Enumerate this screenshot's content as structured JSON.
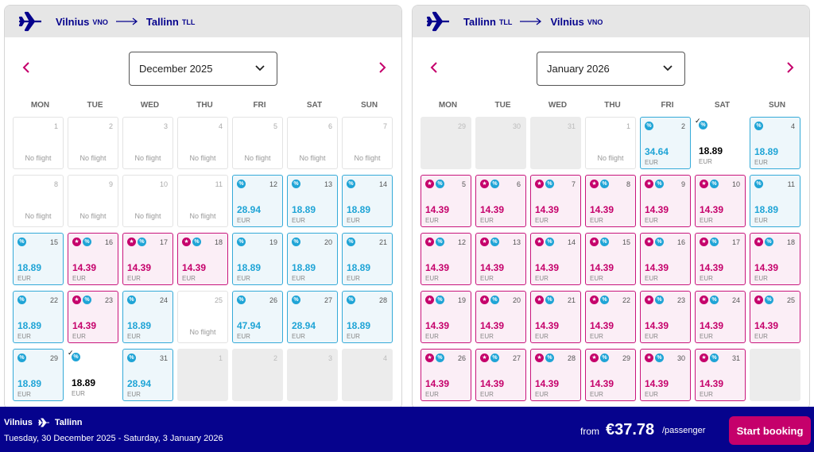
{
  "colors": {
    "brand_navy": "#06038d",
    "brand_pink": "#c5006b",
    "discount_blue": "#1fa4d6",
    "selected_green": "#2e7d4e"
  },
  "outbound": {
    "from_city": "Vilnius",
    "from_code": "VNO",
    "to_city": "Tallinn",
    "to_code": "TLL",
    "month_label": "December 2025",
    "weekdays": [
      "MON",
      "TUE",
      "WED",
      "THU",
      "FRI",
      "SAT",
      "SUN"
    ],
    "days": [
      {
        "day": "1",
        "status": "noflight",
        "label": "No flight"
      },
      {
        "day": "2",
        "status": "noflight",
        "label": "No flight"
      },
      {
        "day": "3",
        "status": "noflight",
        "label": "No flight"
      },
      {
        "day": "4",
        "status": "noflight",
        "label": "No flight"
      },
      {
        "day": "5",
        "status": "noflight",
        "label": "No flight"
      },
      {
        "day": "6",
        "status": "noflight",
        "label": "No flight"
      },
      {
        "day": "7",
        "status": "noflight",
        "label": "No flight"
      },
      {
        "day": "8",
        "status": "noflight",
        "label": "No flight"
      },
      {
        "day": "9",
        "status": "noflight",
        "label": "No flight"
      },
      {
        "day": "10",
        "status": "noflight",
        "label": "No flight"
      },
      {
        "day": "11",
        "status": "noflight",
        "label": "No flight"
      },
      {
        "day": "12",
        "status": "blue",
        "price": "28.94",
        "currency": "EUR"
      },
      {
        "day": "13",
        "status": "blue",
        "price": "18.89",
        "currency": "EUR"
      },
      {
        "day": "14",
        "status": "blue",
        "price": "18.89",
        "currency": "EUR"
      },
      {
        "day": "15",
        "status": "blue",
        "price": "18.89",
        "currency": "EUR"
      },
      {
        "day": "16",
        "status": "pink",
        "price": "14.39",
        "currency": "EUR"
      },
      {
        "day": "17",
        "status": "pink",
        "price": "14.39",
        "currency": "EUR"
      },
      {
        "day": "18",
        "status": "pink",
        "price": "14.39",
        "currency": "EUR"
      },
      {
        "day": "19",
        "status": "blue",
        "price": "18.89",
        "currency": "EUR"
      },
      {
        "day": "20",
        "status": "blue",
        "price": "18.89",
        "currency": "EUR"
      },
      {
        "day": "21",
        "status": "blue",
        "price": "18.89",
        "currency": "EUR"
      },
      {
        "day": "22",
        "status": "blue",
        "price": "18.89",
        "currency": "EUR"
      },
      {
        "day": "23",
        "status": "pink",
        "price": "14.39",
        "currency": "EUR"
      },
      {
        "day": "24",
        "status": "blue",
        "price": "18.89",
        "currency": "EUR"
      },
      {
        "day": "25",
        "status": "noflight",
        "label": "No flight"
      },
      {
        "day": "26",
        "status": "blue",
        "price": "47.94",
        "currency": "EUR"
      },
      {
        "day": "27",
        "status": "blue",
        "price": "28.94",
        "currency": "EUR"
      },
      {
        "day": "28",
        "status": "blue",
        "price": "18.89",
        "currency": "EUR"
      },
      {
        "day": "29",
        "status": "blue",
        "price": "18.89",
        "currency": "EUR"
      },
      {
        "day": "30",
        "status": "selected",
        "price": "18.89",
        "currency": "EUR"
      },
      {
        "day": "31",
        "status": "blue",
        "price": "28.94",
        "currency": "EUR"
      },
      {
        "day": "1",
        "status": "grey"
      },
      {
        "day": "2",
        "status": "grey"
      },
      {
        "day": "3",
        "status": "grey"
      },
      {
        "day": "4",
        "status": "grey"
      }
    ]
  },
  "inbound": {
    "from_city": "Tallinn",
    "from_code": "TLL",
    "to_city": "Vilnius",
    "to_code": "VNO",
    "month_label": "January 2026",
    "weekdays": [
      "MON",
      "TUE",
      "WED",
      "THU",
      "FRI",
      "SAT",
      "SUN"
    ],
    "days": [
      {
        "day": "29",
        "status": "grey"
      },
      {
        "day": "30",
        "status": "grey"
      },
      {
        "day": "31",
        "status": "grey"
      },
      {
        "day": "1",
        "status": "noflight",
        "label": "No flight"
      },
      {
        "day": "2",
        "status": "blue",
        "price": "34.64",
        "currency": "EUR"
      },
      {
        "day": "3",
        "status": "selected",
        "price": "18.89",
        "currency": "EUR"
      },
      {
        "day": "4",
        "status": "blue",
        "price": "18.89",
        "currency": "EUR"
      },
      {
        "day": "5",
        "status": "pink",
        "price": "14.39",
        "currency": "EUR"
      },
      {
        "day": "6",
        "status": "pink",
        "price": "14.39",
        "currency": "EUR"
      },
      {
        "day": "7",
        "status": "pink",
        "price": "14.39",
        "currency": "EUR"
      },
      {
        "day": "8",
        "status": "pink",
        "price": "14.39",
        "currency": "EUR"
      },
      {
        "day": "9",
        "status": "pink",
        "price": "14.39",
        "currency": "EUR"
      },
      {
        "day": "10",
        "status": "pink",
        "price": "14.39",
        "currency": "EUR"
      },
      {
        "day": "11",
        "status": "blue",
        "price": "18.89",
        "currency": "EUR"
      },
      {
        "day": "12",
        "status": "pink",
        "price": "14.39",
        "currency": "EUR"
      },
      {
        "day": "13",
        "status": "pink",
        "price": "14.39",
        "currency": "EUR"
      },
      {
        "day": "14",
        "status": "pink",
        "price": "14.39",
        "currency": "EUR"
      },
      {
        "day": "15",
        "status": "pink",
        "price": "14.39",
        "currency": "EUR"
      },
      {
        "day": "16",
        "status": "pink",
        "price": "14.39",
        "currency": "EUR"
      },
      {
        "day": "17",
        "status": "pink",
        "price": "14.39",
        "currency": "EUR"
      },
      {
        "day": "18",
        "status": "pink",
        "price": "14.39",
        "currency": "EUR"
      },
      {
        "day": "19",
        "status": "pink",
        "price": "14.39",
        "currency": "EUR"
      },
      {
        "day": "20",
        "status": "pink",
        "price": "14.39",
        "currency": "EUR"
      },
      {
        "day": "21",
        "status": "pink",
        "price": "14.39",
        "currency": "EUR"
      },
      {
        "day": "22",
        "status": "pink",
        "price": "14.39",
        "currency": "EUR"
      },
      {
        "day": "23",
        "status": "pink",
        "price": "14.39",
        "currency": "EUR"
      },
      {
        "day": "24",
        "status": "pink",
        "price": "14.39",
        "currency": "EUR"
      },
      {
        "day": "25",
        "status": "pink",
        "price": "14.39",
        "currency": "EUR"
      },
      {
        "day": "26",
        "status": "pink",
        "price": "14.39",
        "currency": "EUR"
      },
      {
        "day": "27",
        "status": "pink",
        "price": "14.39",
        "currency": "EUR"
      },
      {
        "day": "28",
        "status": "pink",
        "price": "14.39",
        "currency": "EUR"
      },
      {
        "day": "29",
        "status": "pink",
        "price": "14.39",
        "currency": "EUR"
      },
      {
        "day": "30",
        "status": "pink",
        "price": "14.39",
        "currency": "EUR"
      },
      {
        "day": "31",
        "status": "pink",
        "price": "14.39",
        "currency": "EUR"
      },
      {
        "day": "",
        "status": "grey"
      }
    ]
  },
  "footer": {
    "from_city": "Vilnius",
    "to_city": "Tallinn",
    "dates": "Tuesday, 30 December 2025 - Saturday, 3 January 2026",
    "from_label": "from",
    "price": "€37.78",
    "per_passenger": "/passenger",
    "cta": "Start booking"
  }
}
